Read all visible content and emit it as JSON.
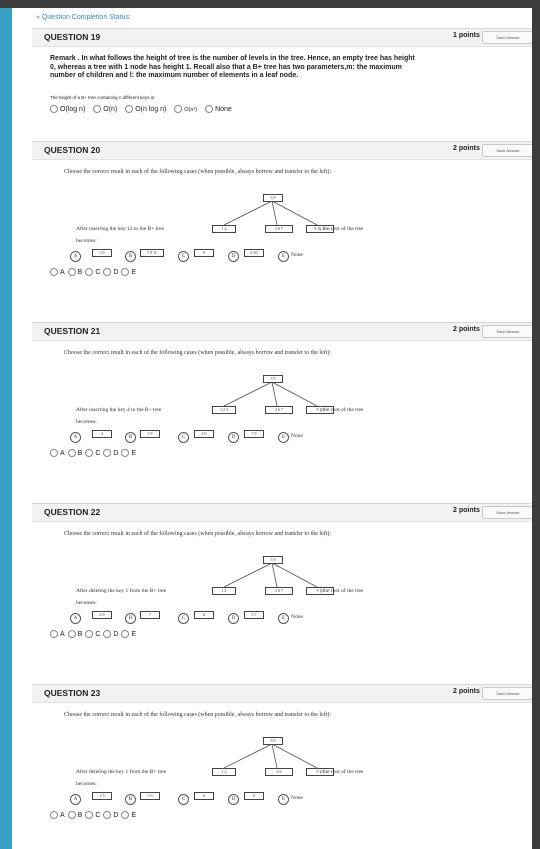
{
  "status_link": "» Question Completion Status:",
  "save_label": "Save Answer",
  "q19": {
    "title": "QUESTION 19",
    "points": "1 points",
    "remark": "Remark . In what follows the height of tree is the number of levels in the tree. Hence, an empty tree has height 0, whereas a tree with 1 node has height 1. Recall also that a B+ tree has two parameters,m: the maximum number of children and l: the maximum number of elements in a leaf node.",
    "prompt": "The height of a B+ tree containing n different keys is:",
    "options": [
      "O(log n)",
      "O(n)",
      "O(n log n)",
      "O(n²)",
      "None"
    ]
  },
  "questions": [
    {
      "title": "QUESTION 20",
      "points": "2 points",
      "instruction": "Choose the correct result in each of the following cases (when possible, always borrow and transfer to the left):",
      "tree_root": "3 9",
      "tree_leaves": [
        "1 2",
        "3 6 7",
        "9 10 11"
      ],
      "action": "After inserting the key 12 to the B+ tree",
      "root_text": ", the root of the tree",
      "becomes": "becomes:",
      "answers": [
        "3 9",
        "7 9 11",
        "9",
        "6 10"
      ],
      "none_label": "None"
    },
    {
      "title": "QUESTION 21",
      "points": "2 points",
      "instruction": "Choose the correct result in each of the following cases (when possible, always borrow and transfer to the left):",
      "tree_root": "3 9",
      "tree_leaves": [
        "1 2 3",
        "3 6 7",
        "9 10"
      ],
      "action": "After inserting the key 4 to the B+ tree",
      "root_text": ", the root of the tree",
      "becomes": "becomes:",
      "answers": [
        "4",
        "3 9",
        "4 9",
        "7 9"
      ],
      "none_label": "None"
    },
    {
      "title": "QUESTION 22",
      "points": "2 points",
      "instruction": "Choose the correct result in each of the following cases (when possible, always borrow and transfer to the left):",
      "tree_root": "3 9",
      "tree_leaves": [
        "1 2",
        "3 6 7",
        "9 10"
      ],
      "action": "After deleting the key 1 from the B+ tree",
      "root_text": ", the root of the tree",
      "becomes": "becomes:",
      "answers": [
        "6 9",
        "7",
        "6",
        "5 7"
      ],
      "none_label": "None"
    },
    {
      "title": "QUESTION 23",
      "points": "2 points",
      "instruction": "Choose the correct result in each of the following cases (when possible, always borrow and transfer to the left):",
      "tree_root": "3 9",
      "tree_leaves": [
        "1 2",
        "5 6",
        "9 10"
      ],
      "action": "After deleting the key 1 from the B+ tree",
      "root_text": ", the root of the tree",
      "becomes": "becomes:",
      "answers": [
        "2 9",
        "5 9",
        "6",
        "9"
      ],
      "none_label": "None"
    }
  ],
  "option_letters": [
    "A",
    "B",
    "C",
    "D",
    "E"
  ],
  "radio_labels": [
    "A",
    "B",
    "C",
    "D",
    "E"
  ]
}
